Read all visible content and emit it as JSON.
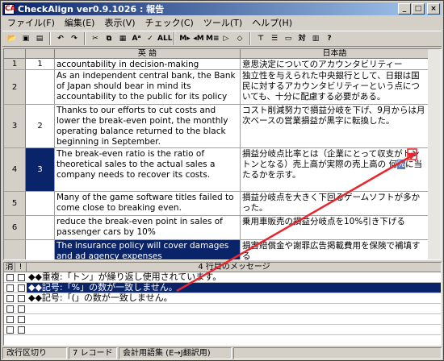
{
  "window": {
    "title": "CheckAlign ver0.9.1026 : 報告",
    "app_icon": "CA",
    "btn_min": "_",
    "btn_max": "□",
    "btn_close": "×"
  },
  "menu": [
    "ファイル(F)",
    "編集(E)",
    "表示(V)",
    "チェック(C)",
    "ツール(T)",
    "ヘルプ(H)"
  ],
  "toolbar": [
    {
      "name": "open-folder-icon",
      "glyph": "📂"
    },
    {
      "name": "save-icon",
      "glyph": "▣"
    },
    {
      "name": "print-icon",
      "glyph": "▤"
    },
    {
      "sep": true
    },
    {
      "name": "undo-icon",
      "glyph": "↶"
    },
    {
      "name": "redo-icon",
      "glyph": "↷"
    },
    {
      "sep": true
    },
    {
      "name": "cut-icon",
      "glyph": "✂"
    },
    {
      "name": "copy-icon",
      "glyph": "⧉"
    },
    {
      "name": "paste-icon",
      "glyph": "▦"
    },
    {
      "name": "font-icon",
      "glyph": "Aᵃ"
    },
    {
      "name": "check-icon",
      "glyph": "✓"
    },
    {
      "name": "check-all-icon",
      "glyph": "ALL"
    },
    {
      "sep": true
    },
    {
      "name": "move-right-icon",
      "glyph": "M▸"
    },
    {
      "name": "move-left-icon",
      "glyph": "◂M"
    },
    {
      "name": "merge-icon",
      "glyph": "M≡"
    },
    {
      "name": "insert-icon",
      "glyph": "▷"
    },
    {
      "name": "delete-icon",
      "glyph": "◇"
    },
    {
      "sep": true
    },
    {
      "name": "split-icon",
      "glyph": "⊤"
    },
    {
      "name": "align-icon",
      "glyph": "☰"
    },
    {
      "name": "minus-icon",
      "glyph": "▭"
    },
    {
      "name": "pair-icon",
      "glyph": "対"
    },
    {
      "name": "columns-icon",
      "glyph": "▥"
    },
    {
      "name": "help-icon",
      "glyph": "?"
    }
  ],
  "grid": {
    "headers": {
      "en": "英 語",
      "ja": "日本語"
    },
    "rows": [
      {
        "row": "1",
        "seg": "1",
        "en": "accountability in decision-making",
        "ja": "意思決定についてのアカウンタビリティー"
      },
      {
        "row": "2",
        "seg": "",
        "en": "As an independent central bank, the Bank of Japan should bear in mind its accountability to the public for its policy measures.",
        "ja": "独立性を与えられた中央銀行として、日銀は国民に対するアカウンタビリティーという点についても、十分に配慮する必要がある。"
      },
      {
        "row": "3",
        "seg": "2",
        "en": "Thanks to our efforts to cut costs and lower the break-even point, the monthly operating balance returned to the black beginning in September.",
        "ja": "コスト削減努力で損益分岐を下げ、9月からは月次ベースの営業損益が黒字に転換した。"
      },
      {
        "row": "4",
        "seg": "3",
        "en": "The break-even ratio is the ratio of theoretical sales to the actual sales a company needs to recover its costs.",
        "ja_pre": "損益分岐点比率とは（企業にとって収支がトントンとなる）売上高が実際の売上高の 何",
        "ja_mark": "%",
        "ja_post": "に当たるかを示す。"
      },
      {
        "row": "5",
        "seg": "",
        "en": "Many of the game software titles failed to come close to breaking even.",
        "ja": "損益分岐点を大きく下回るゲームソフトが多かった。"
      },
      {
        "row": "6",
        "seg": "",
        "en": "reduce the break-even point in sales of passenger cars by 10%",
        "ja": "乗用車販売の損益分岐点を10%引き下げる"
      },
      {
        "row": "",
        "seg": "",
        "en": "The insurance policy will cover damages and ad agency expenses",
        "ja": "損害賠償金や謝罪広告掲載費用を保険で補填する"
      }
    ]
  },
  "messages": {
    "header_check": "消",
    "header_flag": "!",
    "header_title": "4 行目のメッセージ",
    "items": [
      "◆◆重複:「トン」が繰り返し使用されています。",
      "◆◆記号:「%」の数が一致しません。",
      "◆◆記号:「(」の数が一致しません。"
    ]
  },
  "status": {
    "mode": "改行区切り",
    "records": "7 レコード",
    "dictionary": "会計用語集 (E→J翻訳用)"
  }
}
